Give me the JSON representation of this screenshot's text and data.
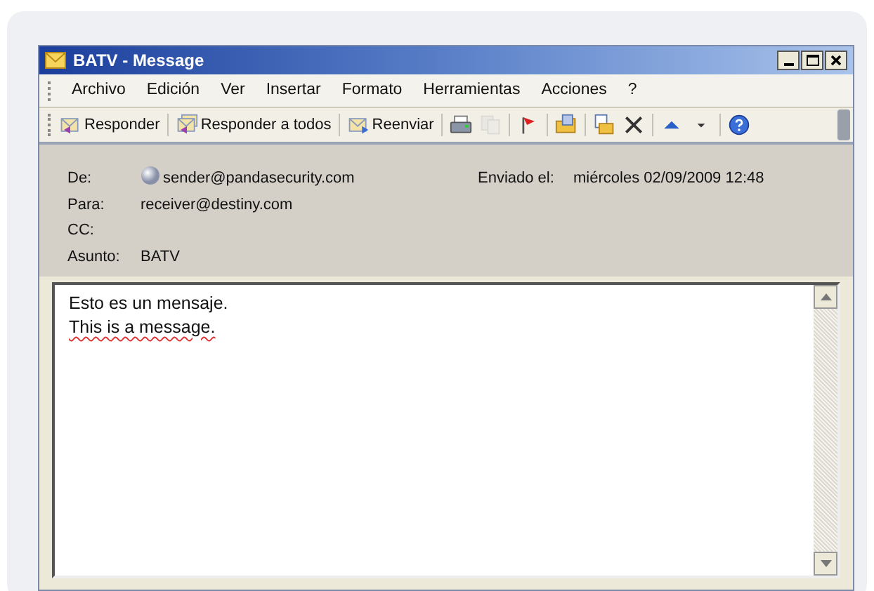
{
  "window": {
    "title": "BATV - Message"
  },
  "menu": [
    "Archivo",
    "Edición",
    "Ver",
    "Insertar",
    "Formato",
    "Herramientas",
    "Acciones",
    "?"
  ],
  "toolbar": [
    {
      "kind": "text",
      "label": "Responder"
    },
    {
      "kind": "text",
      "label": "Responder a todos"
    },
    {
      "kind": "text",
      "label": "Reenviar"
    },
    {
      "kind": "icon",
      "disabled": false
    },
    {
      "kind": "icon",
      "disabled": true
    },
    {
      "kind": "icon",
      "disabled": false
    },
    {
      "kind": "icon",
      "disabled": false
    },
    {
      "kind": "icon",
      "disabled": false
    },
    {
      "kind": "icon",
      "disabled": false
    },
    {
      "kind": "icon",
      "disabled": false
    },
    {
      "kind": "icon",
      "disabled": false
    },
    {
      "kind": "icon",
      "disabled": false
    }
  ],
  "header": {
    "from_label": "De:",
    "from": "sender@pandasecurity.com",
    "sent_label": "Enviado el:",
    "sent": "miércoles 02/09/2009 12:48",
    "to_label": "Para:",
    "to": "receiver@destiny.com",
    "cc_label": "CC:",
    "subject_label": "Asunto:",
    "subject": "BATV"
  },
  "body": [
    {
      "text": "Esto es un mensaje.",
      "misspelled": false
    },
    {
      "text": "This is a message.",
      "misspelled": true
    }
  ]
}
